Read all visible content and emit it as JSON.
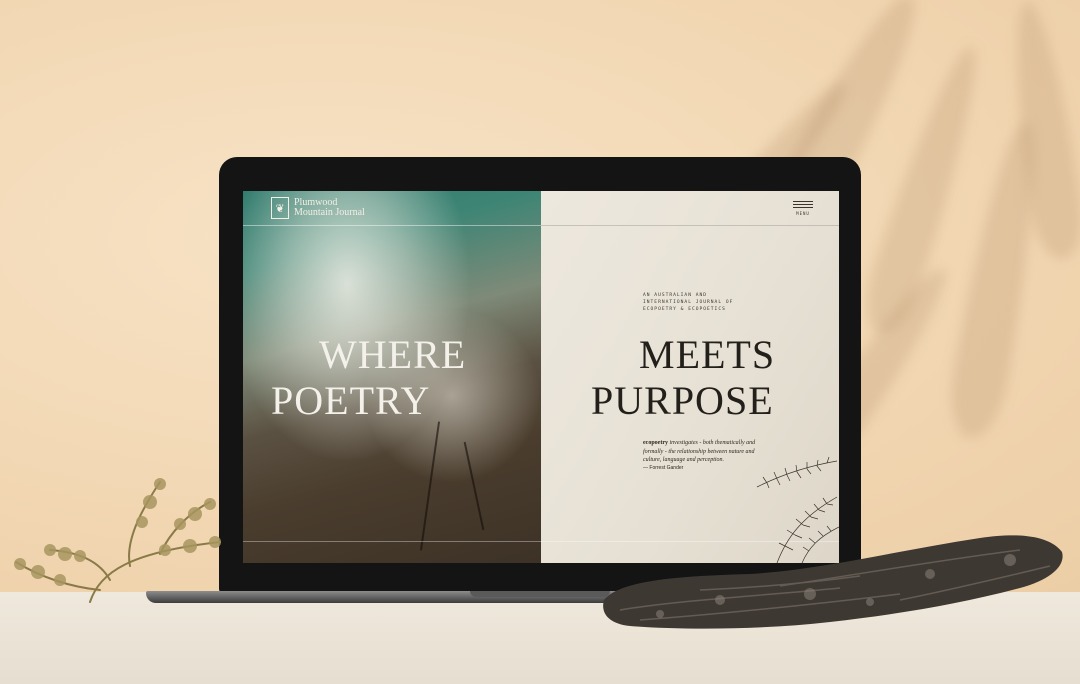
{
  "screen": {
    "logo_mark": "❦",
    "logo_line1": "Plumwood",
    "logo_line2": "Mountain Journal",
    "menu_label": "MENU",
    "headline_left_1": "WHERE",
    "headline_left_2": "POETRY",
    "headline_right_1": "MEETS",
    "headline_right_2": "PURPOSE",
    "tagline": "AN AUSTRALIAN AND INTERNATIONAL JOURNAL OF ECOPOETRY & ECOPOETICS",
    "quote_lead": "ecopoetry",
    "quote_body": " investigates - both thematically and formally - the relationship between nature and culture, language and perception.",
    "quote_author": "— Forrest Gander"
  },
  "icons": {
    "menu": "hamburger-icon",
    "logo": "leaf-emblem-icon"
  },
  "colors": {
    "backdrop": "#f3dcbb",
    "laptop_bezel": "#141414",
    "headline_light": "#f4f1ea",
    "headline_dark": "#231f1a"
  }
}
